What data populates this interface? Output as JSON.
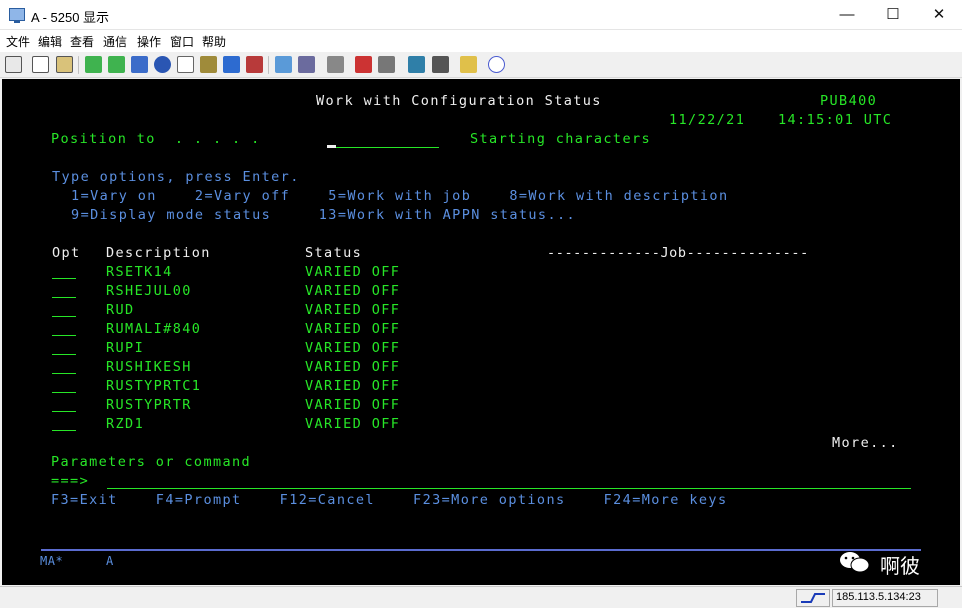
{
  "window": {
    "title": "A - 5250 显示",
    "min": "—",
    "max": "☐",
    "close": "✕"
  },
  "menu": [
    "文件",
    "编辑",
    "查看",
    "通信",
    "操作",
    "窗口",
    "帮助"
  ],
  "toolbar_icons": [
    "copy-icon",
    "paste-icon",
    "clipboard-icon",
    "send-file-icon",
    "receive-file-icon",
    "macro-icon",
    "play-icon",
    "notes-icon",
    "color-map-icon",
    "keyboard-map-icon",
    "settings-icon",
    "display-setup-icon",
    "record-icon",
    "stop-icon",
    "print-icon",
    "help-icon"
  ],
  "screen": {
    "title": "Work with Configuration Status",
    "system": "PUB400",
    "date": "11/22/21",
    "time": "14:15:01 UTC",
    "position_label": "Position to  . . . . .",
    "position_hint": "Starting characters",
    "instructions": "Type options, press Enter.",
    "options_line1": "  1=Vary on    2=Vary off    5=Work with job    8=Work with description",
    "options_line2": "  9=Display mode status     13=Work with APPN status...",
    "col_opt": "Opt",
    "col_description": "Description",
    "col_status": "Status",
    "col_job": "-------------Job--------------",
    "rows": [
      {
        "description": "RSETK14",
        "status": "VARIED OFF"
      },
      {
        "description": "RSHEJUL00",
        "status": "VARIED OFF"
      },
      {
        "description": "RUD",
        "status": "VARIED OFF"
      },
      {
        "description": "RUMALI#840",
        "status": "VARIED OFF"
      },
      {
        "description": "RUPI",
        "status": "VARIED OFF"
      },
      {
        "description": "RUSHIKESH",
        "status": "VARIED OFF"
      },
      {
        "description": "RUSTYPRTC1",
        "status": "VARIED OFF"
      },
      {
        "description": "RUSTYPRTR",
        "status": "VARIED OFF"
      },
      {
        "description": "RZD1",
        "status": "VARIED OFF"
      }
    ],
    "more": "More...",
    "params_label": "Parameters or command",
    "prompt": "===>",
    "fkeys": "F3=Exit    F4=Prompt    F12=Cancel    F23=More options    F24=More keys",
    "oia_left": "MA*",
    "oia_session": "A"
  },
  "watermark": "啊彼",
  "status": {
    "address": "185.113.5.134:23"
  }
}
